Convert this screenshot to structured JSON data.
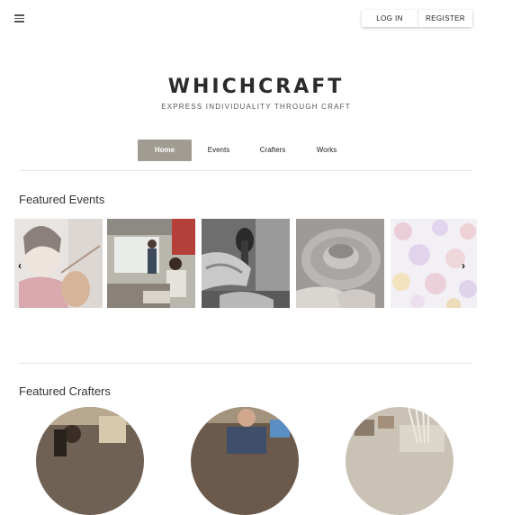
{
  "header": {
    "menu_icon": "hamburger-menu-icon",
    "login_label": "LOG IN",
    "register_label": "REGISTER"
  },
  "brand": {
    "title": "WHICHCRAFT",
    "tagline": "EXPRESS INDIVIDUALITY THROUGH CRAFT"
  },
  "nav": {
    "items": [
      {
        "label": "Home",
        "active": true
      },
      {
        "label": "Events",
        "active": false
      },
      {
        "label": "Crafters",
        "active": false
      },
      {
        "label": "Works",
        "active": false
      }
    ]
  },
  "featured_events": {
    "title": "Featured Events",
    "prev_icon": "chevron-left-icon",
    "next_icon": "chevron-right-icon",
    "images": [
      "violin-student-photo",
      "classroom-presentation-photo",
      "wood-carving-photo",
      "pottery-wheel-photo",
      "floral-fabric-photo"
    ]
  },
  "featured_crafters": {
    "title": "Featured Crafters",
    "avatars": [
      "crafter-workshop-photo",
      "crafter-tools-photo",
      "crafter-studio-photo"
    ]
  },
  "colors": {
    "nav_active_bg": "#a09c92",
    "divider": "#e4e4e4"
  }
}
